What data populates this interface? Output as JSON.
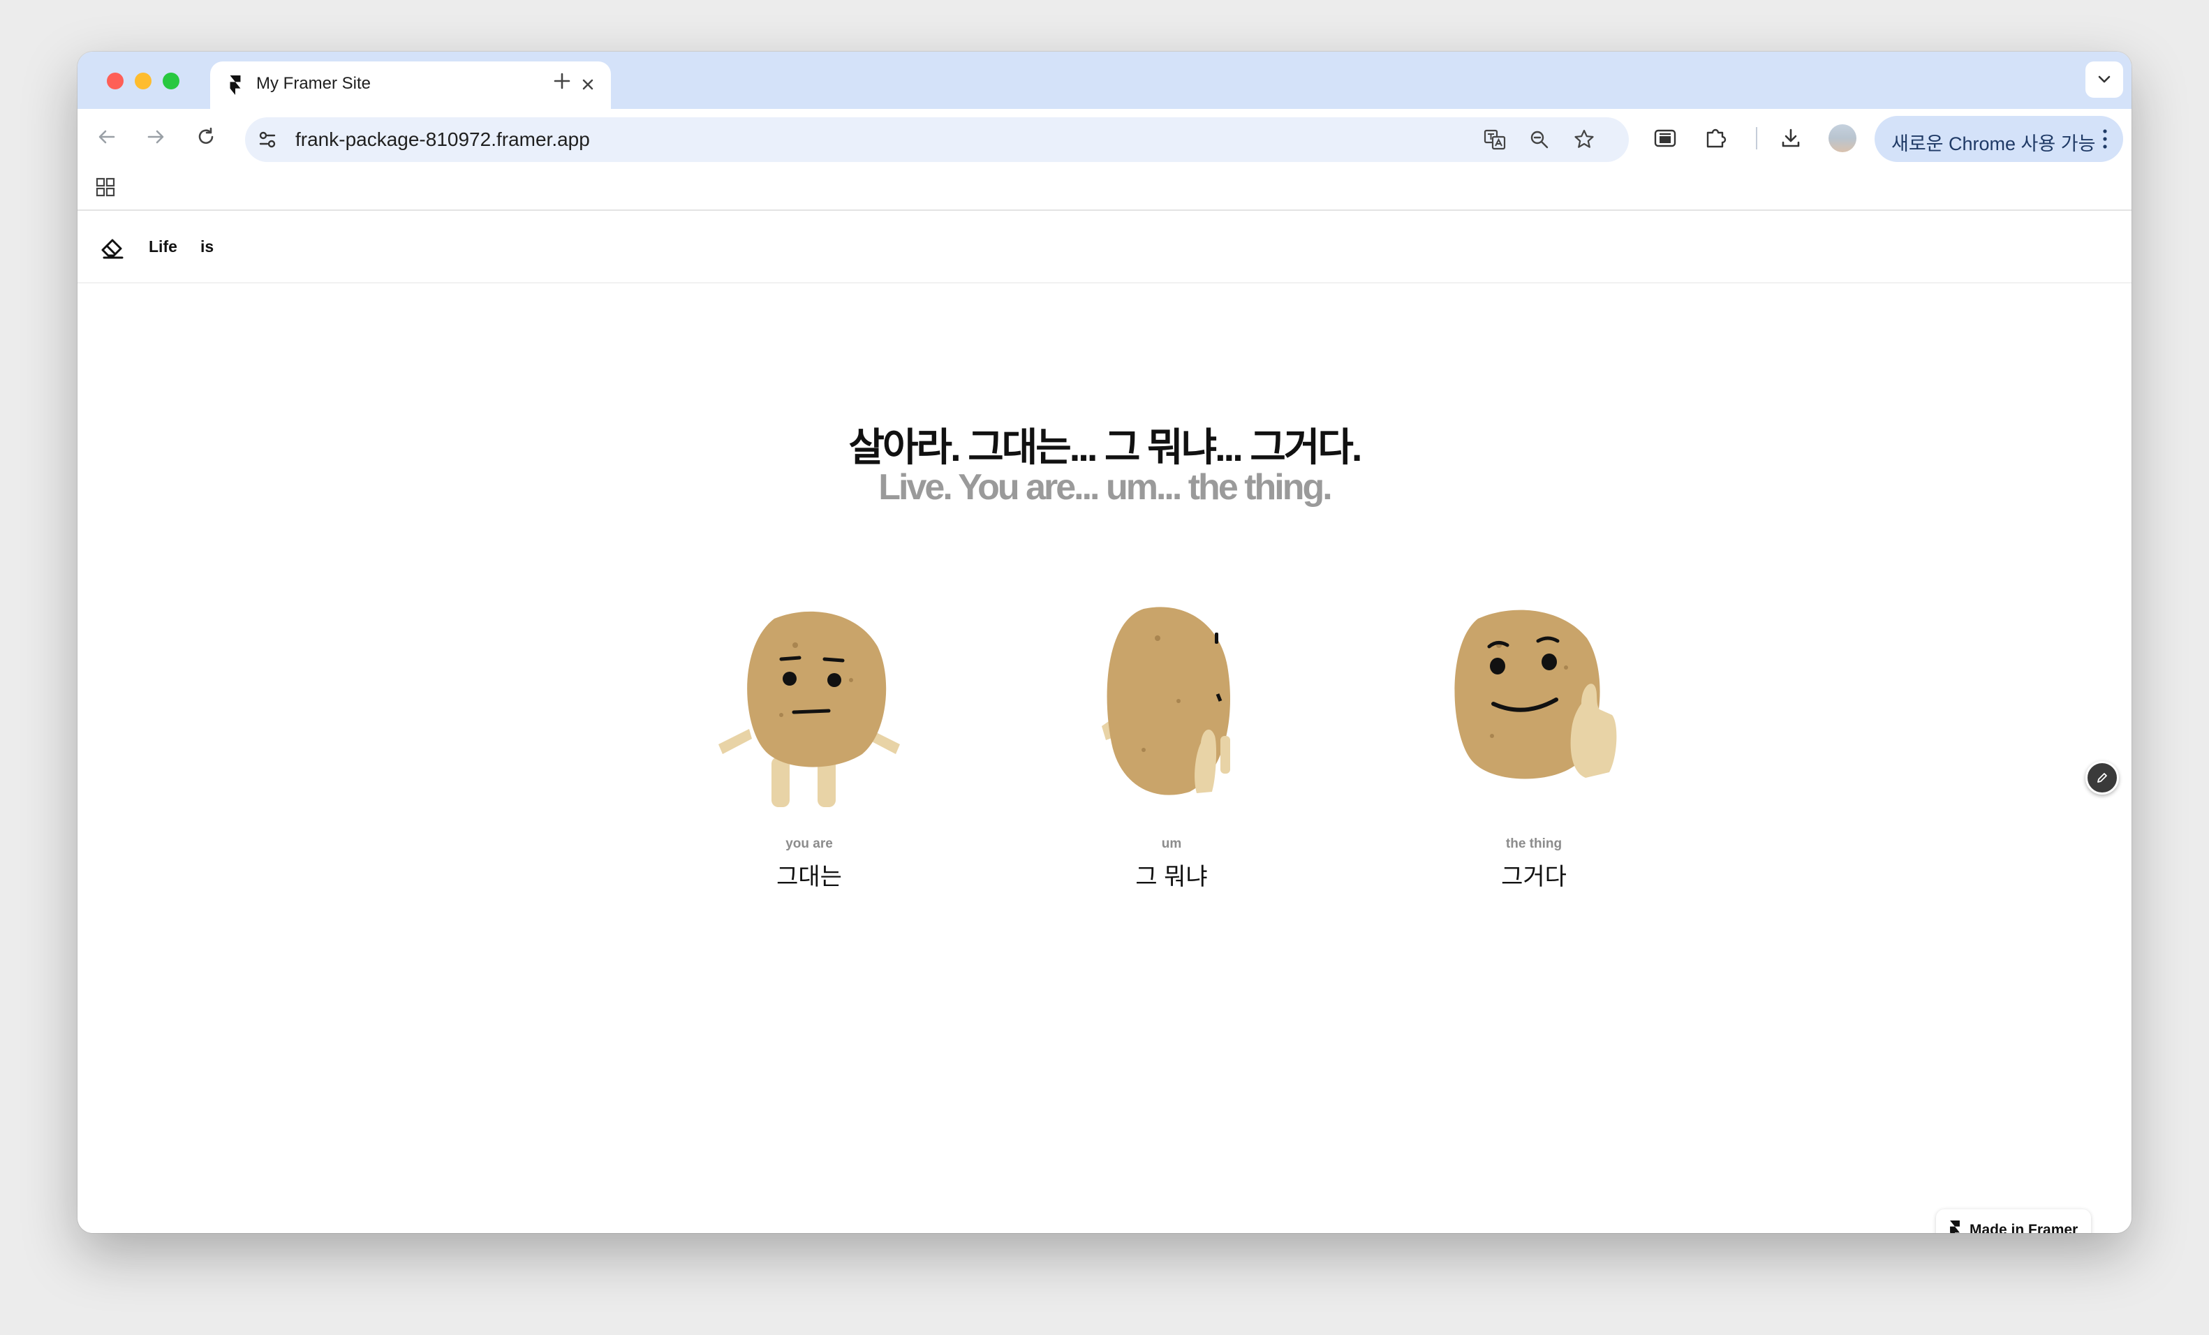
{
  "browser": {
    "tab": {
      "title": "My Framer Site"
    },
    "address": {
      "url": "frank-package-810972.framer.app"
    },
    "update_chip": {
      "label": "새로운 Chrome 사용 가능"
    }
  },
  "site": {
    "nav": {
      "links": [
        "Life",
        "is"
      ]
    },
    "hero": {
      "korean": "살아라.  그대는... 그 뭐냐... 그거다.",
      "english": "Live. You are... um... the thing."
    },
    "cards": [
      {
        "english": "you are",
        "korean": "그대는"
      },
      {
        "english": "um",
        "korean": "그 뭐냐"
      },
      {
        "english": "the thing",
        "korean": "그거다"
      }
    ],
    "badge": {
      "label": "Made in Framer"
    }
  },
  "colors": {
    "tabstrip": "#d4e2f9",
    "omnibox": "#eaf0fb",
    "potato": "#c9a46a",
    "hero_secondary": "#9a9a9a"
  }
}
